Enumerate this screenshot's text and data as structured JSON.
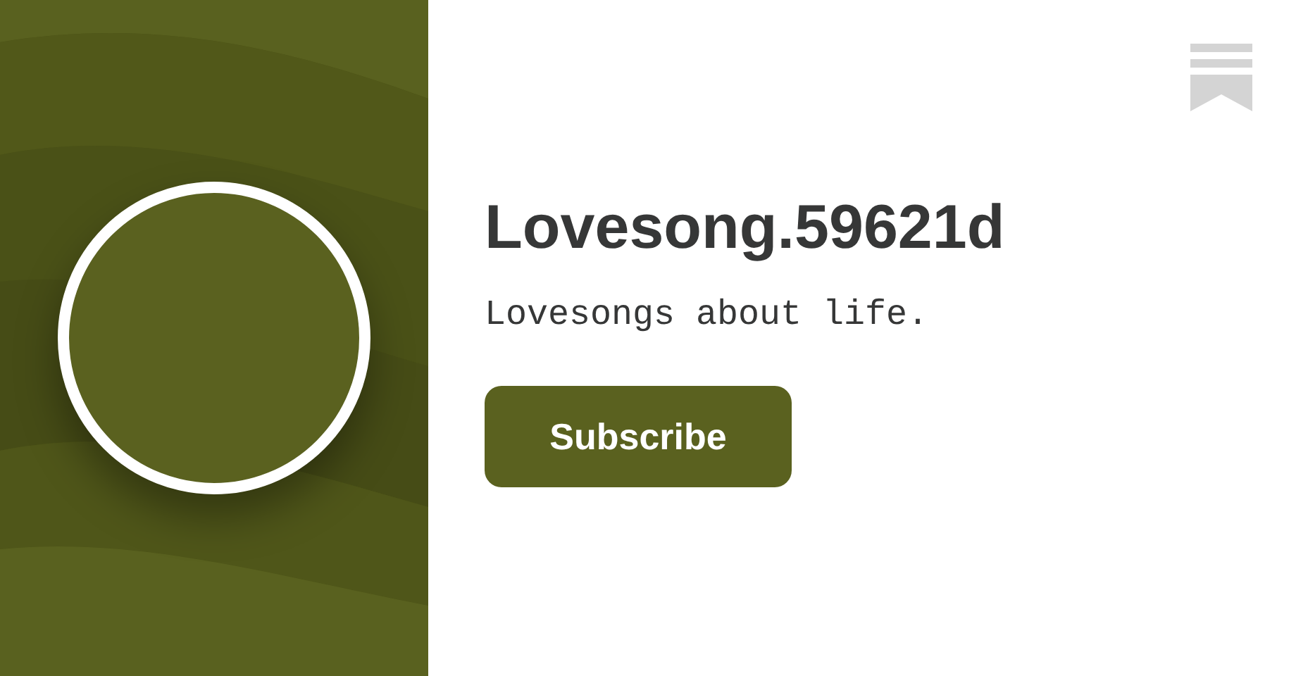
{
  "publication": {
    "name": "Lovesong.59621d",
    "tagline": "Lovesongs about life.",
    "subscribe_button": "Subscribe"
  }
}
